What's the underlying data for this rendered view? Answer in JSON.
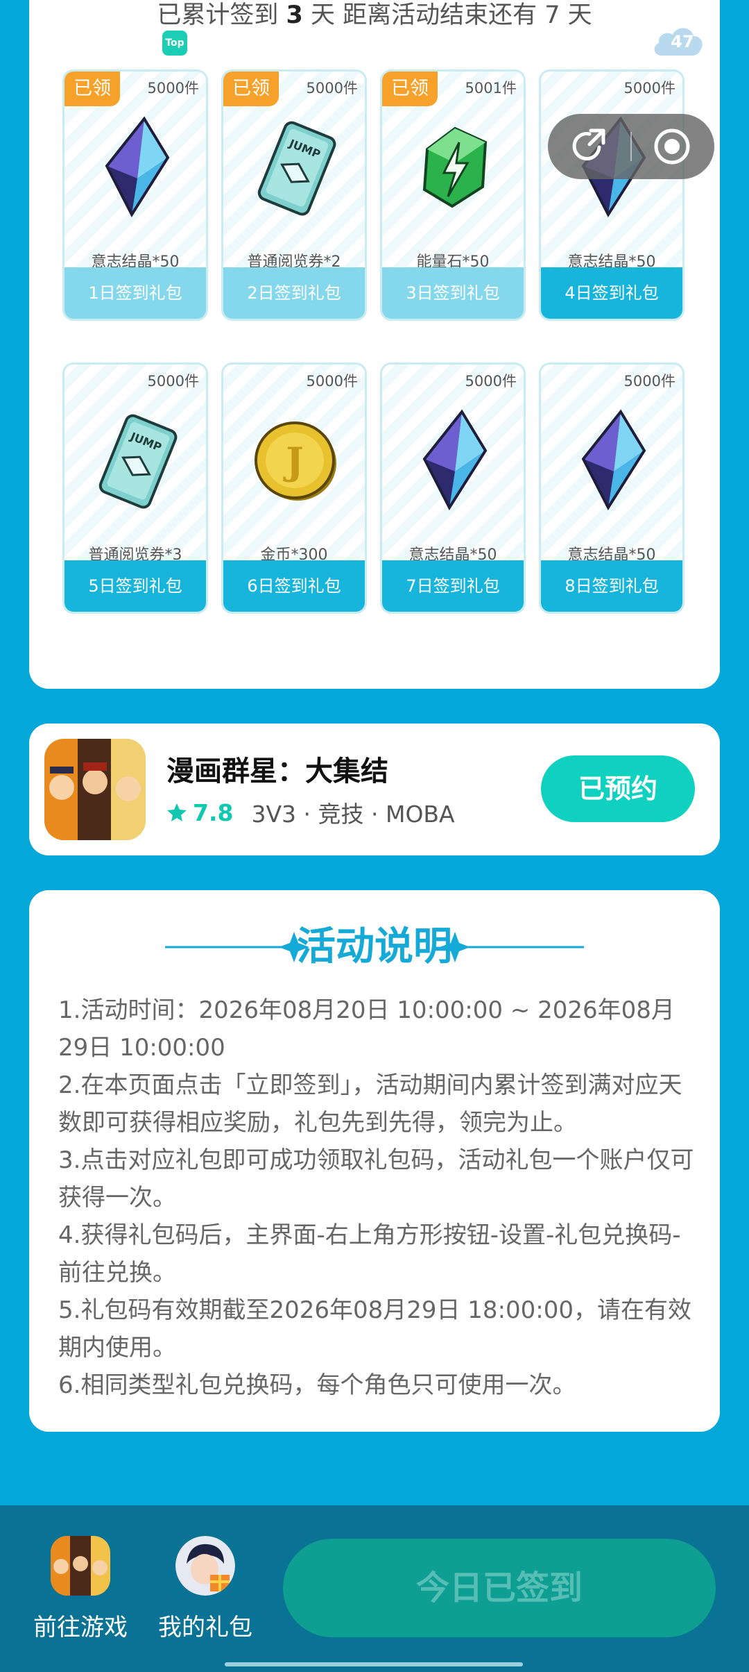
{
  "summary": {
    "prefix": "已累计签到",
    "days": "3",
    "middle": "天  距离活动结束还有",
    "remain": "7",
    "suffix": "天"
  },
  "top_badge": "Top",
  "cloud_count": "47",
  "claimed_label": "已领",
  "rewards": [
    {
      "stock": "5000件",
      "name": "意志结晶*50",
      "day": "1日签到礼包",
      "icon": "crystal-icon",
      "claimed": true
    },
    {
      "stock": "5000件",
      "name": "普通阅览券*2",
      "day": "2日签到礼包",
      "icon": "ticket-icon",
      "claimed": true
    },
    {
      "stock": "5001件",
      "name": "能量石*50",
      "day": "3日签到礼包",
      "icon": "energy-stone-icon",
      "claimed": true
    },
    {
      "stock": "5000件",
      "name": "意志结晶*50",
      "day": "4日签到礼包",
      "icon": "crystal-icon",
      "claimed": false
    },
    {
      "stock": "5000件",
      "name": "普通阅览券*3",
      "day": "5日签到礼包",
      "icon": "ticket-icon",
      "claimed": false
    },
    {
      "stock": "5000件",
      "name": "金币*300",
      "day": "6日签到礼包",
      "icon": "coin-icon",
      "claimed": false
    },
    {
      "stock": "5000件",
      "name": "意志结晶*50",
      "day": "7日签到礼包",
      "icon": "crystal-icon",
      "claimed": false
    },
    {
      "stock": "5000件",
      "name": "意志结晶*50",
      "day": "8日签到礼包",
      "icon": "crystal-icon",
      "claimed": false
    }
  ],
  "game": {
    "title": "漫画群星：大集结",
    "score": "7.8",
    "tags": "3V3 · 竞技 · MOBA",
    "button": "已预约"
  },
  "rules": {
    "title": "活动说明",
    "items": [
      "1.活动时间：2026年08月20日 10:00:00 ~ 2026年08月29日 10:00:00",
      "2.在本页面点击「立即签到」，活动期间内累计签到满对应天数即可获得相应奖励，礼包先到先得，领完为止。",
      "3.点击对应礼包即可成功领取礼包码，活动礼包一个账户仅可获得一次。",
      "4.获得礼包码后，主界面-右上角方形按钮-设置-礼包兑换码-前往兑换。",
      "5.礼包码有效期截至2026年08月29日 18:00:00，请在有效期内使用。",
      "6.相同类型礼包兑换码，每个角色只可使用一次。"
    ]
  },
  "bottom": {
    "go_game": "前往游戏",
    "my_gifts": "我的礼包",
    "checked_in": "今日已签到"
  },
  "colors": {
    "background": "#03a8d8",
    "accent": "#14a9d6",
    "claimed": "#f6a22a",
    "reserve": "#10d1c0",
    "bottom_bar": "#0a7395"
  }
}
